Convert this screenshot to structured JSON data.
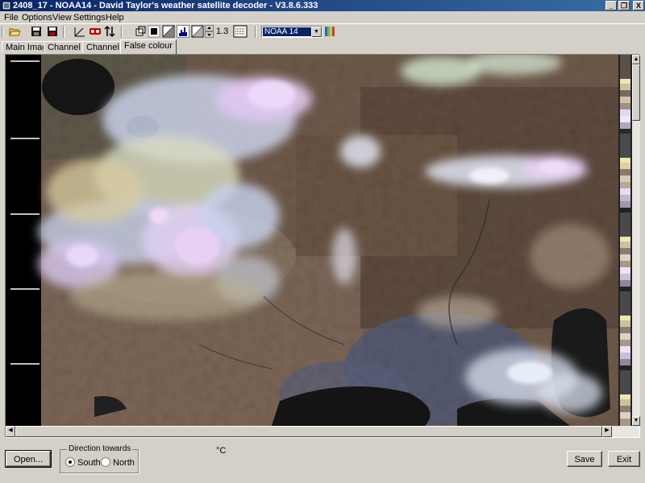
{
  "window": {
    "title": "2408_17 - NOAA14 - David Taylor's weather satellite decoder - V3.8.6.333",
    "caption_buttons": {
      "minimize": "_",
      "maximize": "❐",
      "close": "X"
    }
  },
  "menu": {
    "items": [
      {
        "label": "File"
      },
      {
        "label": "Options"
      },
      {
        "label": "View"
      },
      {
        "label": "Settings"
      },
      {
        "label": "Help"
      }
    ]
  },
  "toolbar": {
    "zoom_value": "1.3",
    "satellite_selected": "NOAA 14",
    "dropdown_arrow": "▼"
  },
  "tabs": [
    {
      "label": "Main Image",
      "active": false
    },
    {
      "label": "Channel A",
      "active": false
    },
    {
      "label": "Channel B",
      "active": false
    },
    {
      "label": "False colour",
      "active": true
    }
  ],
  "scrollbars": {
    "left_arrow": "◀",
    "right_arrow": "▶",
    "up_arrow": "▲",
    "down_arrow": "▼"
  },
  "bottom": {
    "open_label": "Open...",
    "direction_label": "Direction towards",
    "south_label": "South",
    "north_label": "North",
    "selected_direction": "South",
    "temperature_unit": "°C",
    "save_label": "Save",
    "exit_label": "Exit"
  },
  "colors": {
    "titlebar_start": "#0a246a",
    "titlebar_end": "#3a6ea5",
    "window_face": "#d4d0c8"
  }
}
